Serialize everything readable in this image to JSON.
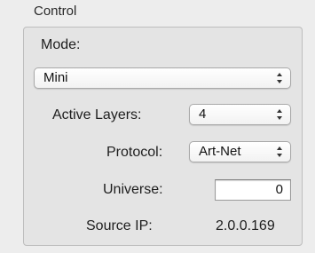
{
  "group": {
    "title": "Control"
  },
  "mode": {
    "label": "Mode:",
    "selected": "Mini"
  },
  "active_layers": {
    "label": "Active Layers:",
    "selected": "4"
  },
  "protocol": {
    "label": "Protocol:",
    "selected": "Art-Net"
  },
  "universe": {
    "label": "Universe:",
    "value": "0"
  },
  "source_ip": {
    "label": "Source IP:",
    "value": "2.0.0.169"
  },
  "icons": {
    "popup_arrows": "up-down-arrows-icon"
  }
}
